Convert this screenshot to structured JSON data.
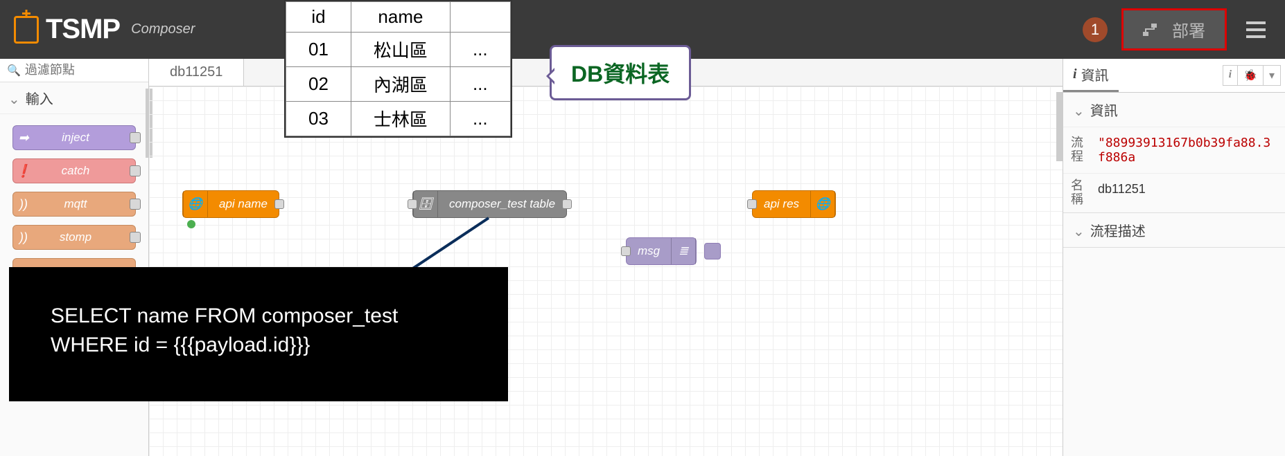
{
  "header": {
    "brand": "TSMP",
    "subtitle": "Composer",
    "step_badge": "1",
    "deploy_label": "部署"
  },
  "left_sidebar": {
    "filter_placeholder": "過濾節點",
    "category_label": "輸入",
    "palette": [
      {
        "label": "inject",
        "kind": "inject"
      },
      {
        "label": "catch",
        "kind": "catch"
      },
      {
        "label": "mqtt",
        "kind": "mqtt"
      },
      {
        "label": "stomp",
        "kind": "stomp"
      }
    ]
  },
  "tabs": {
    "active": "db11251"
  },
  "flow_nodes": {
    "api_in": {
      "label": "api name"
    },
    "db": {
      "label": "composer_test table"
    },
    "api_out": {
      "label": "api res"
    },
    "debug": {
      "label": "msg"
    }
  },
  "data_table": {
    "headers": [
      "id",
      "name"
    ],
    "rows": [
      [
        "01",
        "松山區",
        "..."
      ],
      [
        "02",
        "內湖區",
        "..."
      ],
      [
        "03",
        "士林區",
        "..."
      ]
    ]
  },
  "callout_text": "DB資料表",
  "sql_lines": [
    "SELECT name FROM composer_test",
    "WHERE id = {{{payload.id}}}"
  ],
  "right_sidebar": {
    "tab_label": "資訊",
    "section_info": "資訊",
    "row_flow_label_a": "流",
    "row_flow_label_b": "程",
    "flow_id": "\"88993913167b0b39fa88.3f886a",
    "row_name_label_a": "名",
    "row_name_label_b": "稱",
    "flow_name": "db11251",
    "section_desc": "流程描述"
  }
}
